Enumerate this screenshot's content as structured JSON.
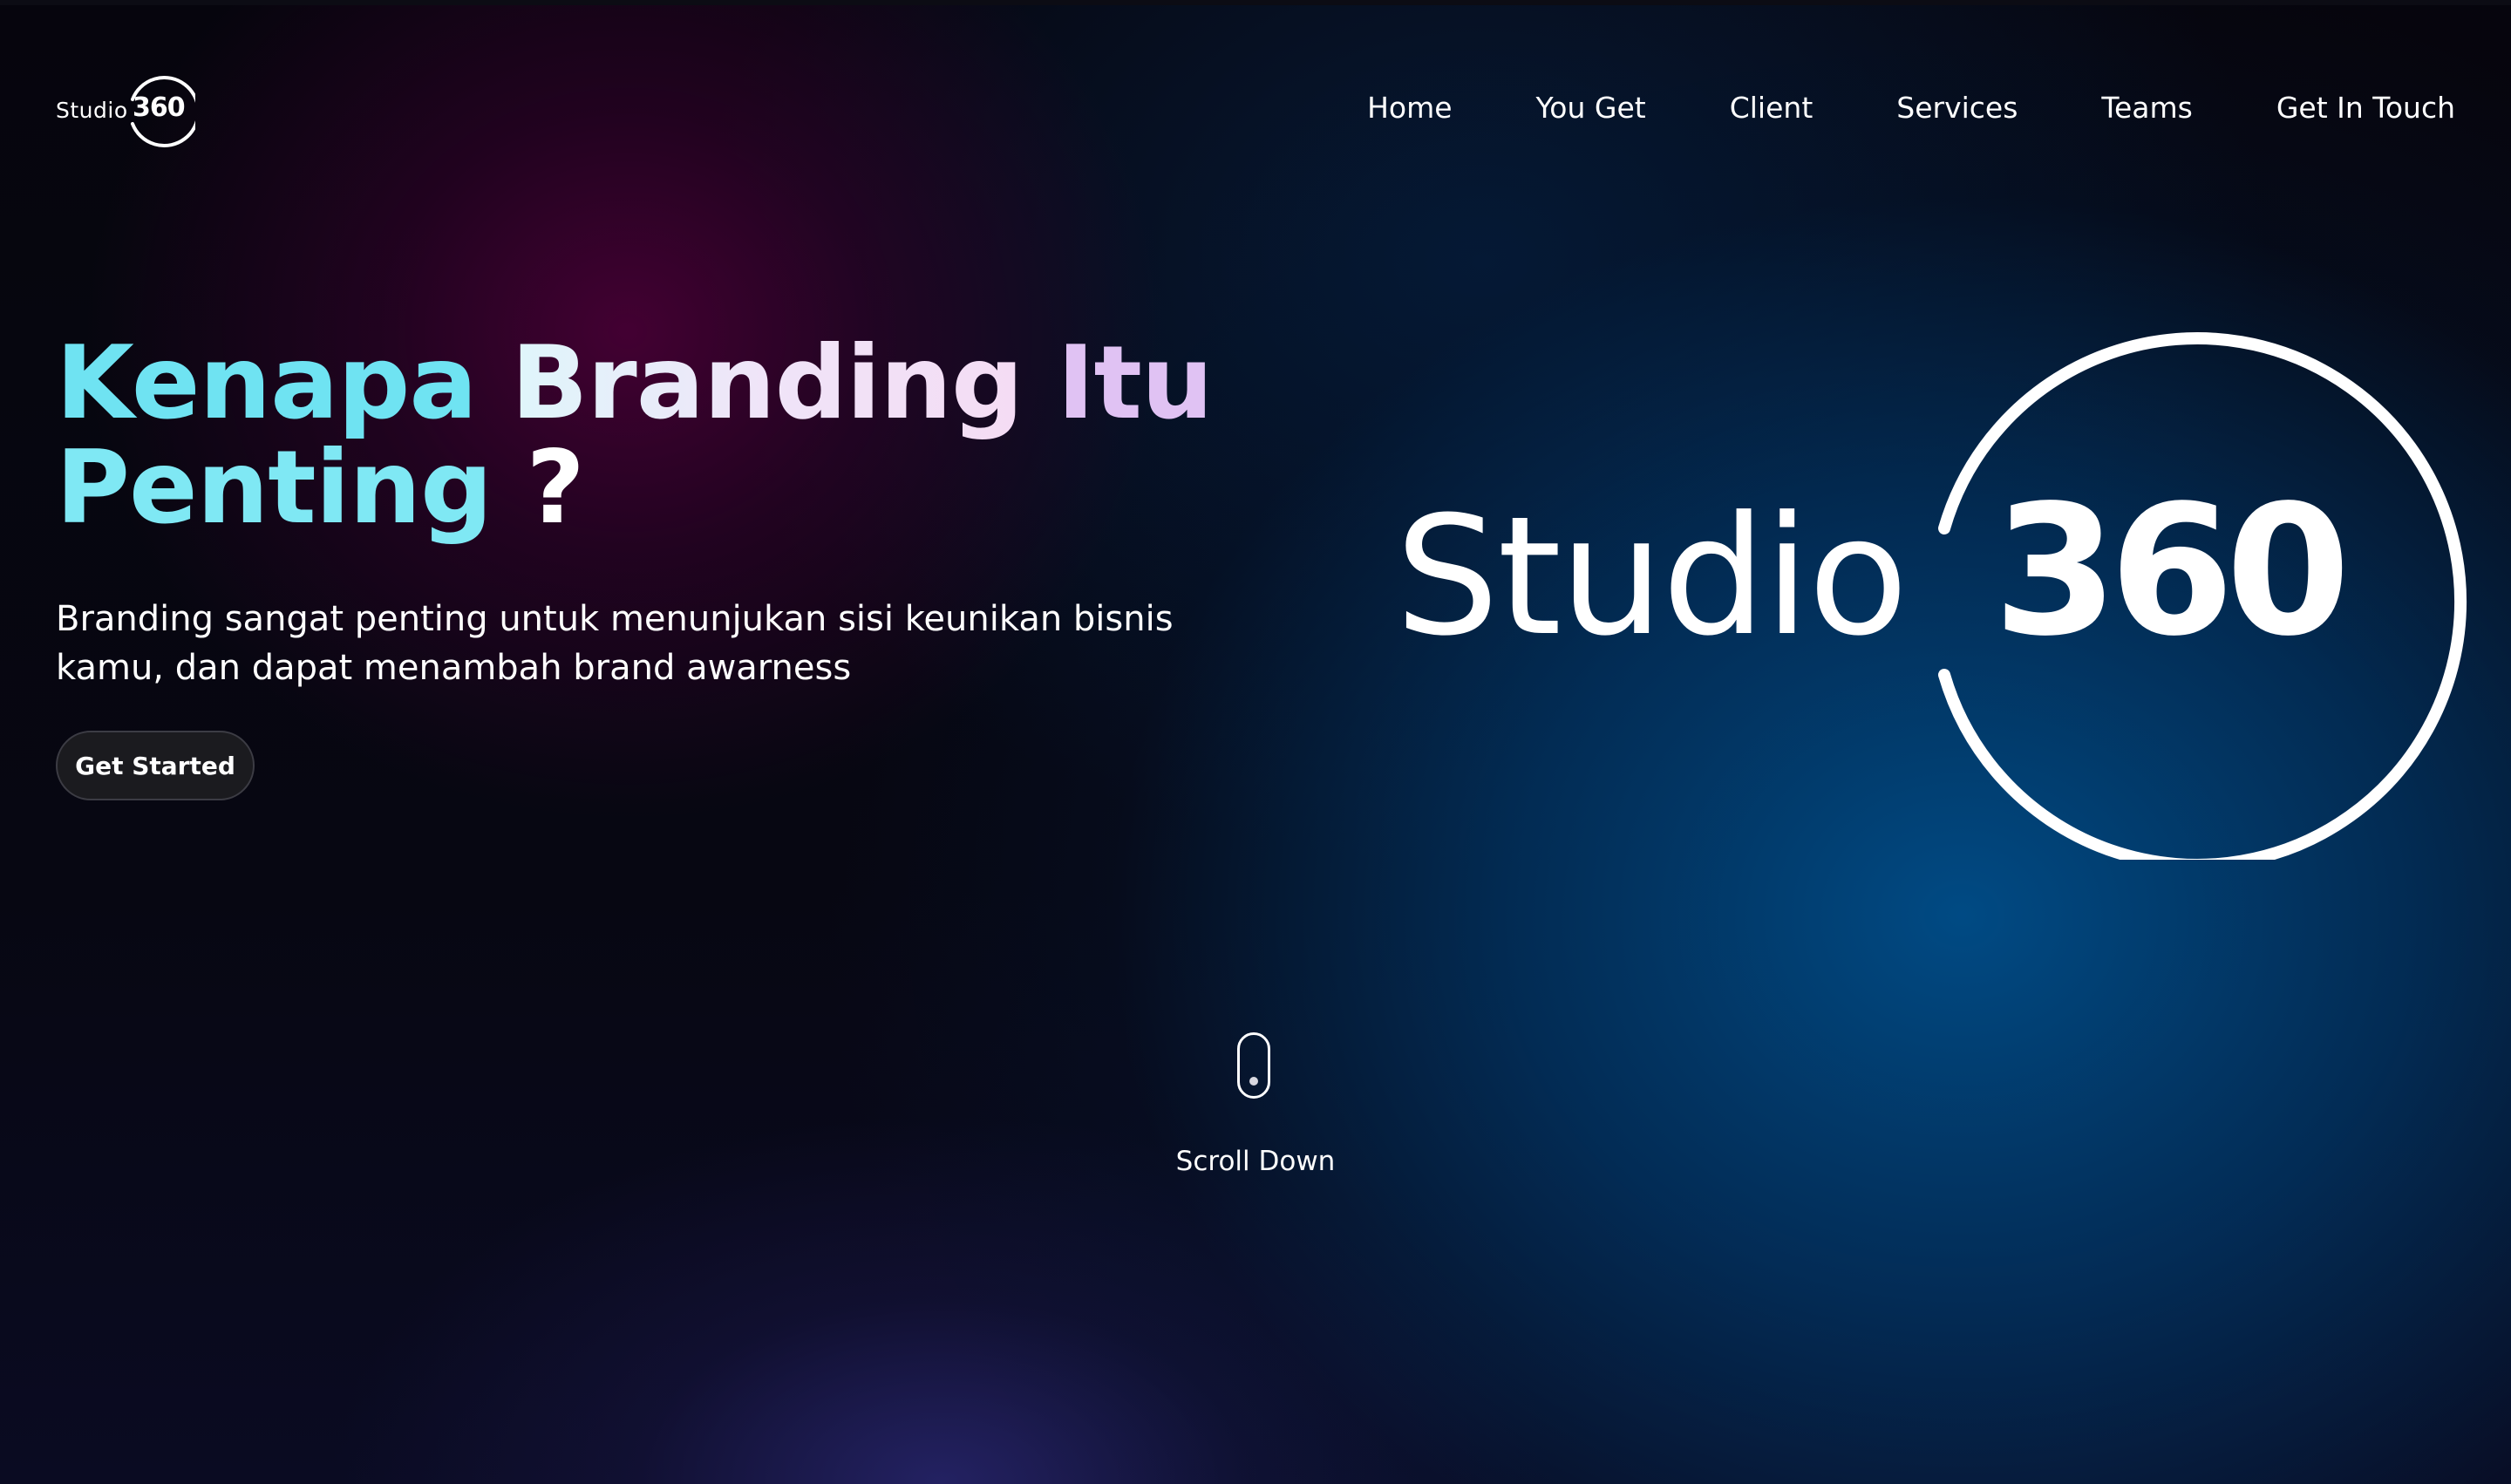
{
  "header": {
    "logo": {
      "word": "Studio",
      "number": "360"
    },
    "nav": [
      {
        "label": "Home"
      },
      {
        "label": "You Get"
      },
      {
        "label": "Client"
      },
      {
        "label": "Services"
      },
      {
        "label": "Teams"
      },
      {
        "label": "Get In Touch"
      }
    ]
  },
  "hero": {
    "headline": {
      "word1": "Kenapa",
      "word2": "Branding",
      "word3": "Itu",
      "word4": "Penting",
      "word5": "?"
    },
    "subtitle": "Branding sangat penting untuk menunjukan sisi keunikan bisnis kamu, dan dapat menambah brand awarness",
    "cta_label": "Get Started",
    "brand_logo": {
      "word": "Studio",
      "number": "360"
    }
  },
  "scroll_indicator": {
    "label": "Scroll Down"
  },
  "colors": {
    "heading_cyan": "#6fe3f2",
    "heading_lilac": "#e0c2f3",
    "background_magenta": "#460034",
    "background_blue": "#004e8a",
    "button_bg": "#1b1b1f"
  }
}
